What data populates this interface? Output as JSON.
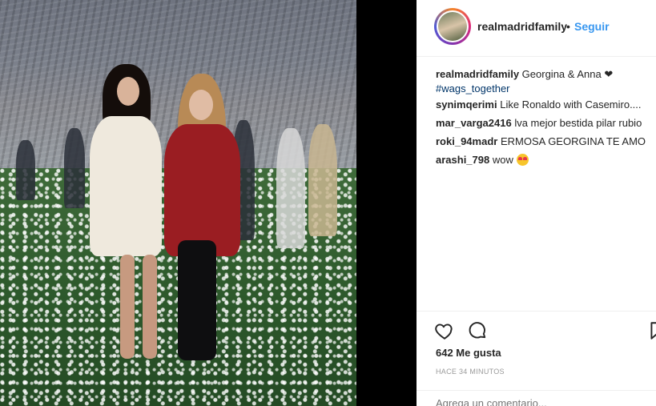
{
  "post": {
    "username": "realmadridfamily",
    "separator": "•",
    "follow_label": "Seguir",
    "caption_text": "Georgina & Anna",
    "caption_emoji": "❤",
    "hashtag": "#wags_together"
  },
  "comments": [
    {
      "user": "synimqerimi",
      "text": "Like Ronaldo with Casemiro...."
    },
    {
      "user": "mar_varga2416",
      "text": "lva mejor bestida pilar rubio"
    },
    {
      "user": "roki_94madr",
      "text": "ERMOSA GEORGINA TE AMO"
    },
    {
      "user": "arashi_798",
      "text": "wow"
    }
  ],
  "actions": {
    "likes_label": "642 Me gusta",
    "time_label": "HACE 34 MINUTOS",
    "add_comment_placeholder": "Agrega un comentario..."
  },
  "icons": {
    "like": "heart-icon",
    "comment": "comment-icon",
    "save": "bookmark-icon",
    "emoji": "heart-eyes-emoji"
  },
  "colors": {
    "link_blue": "#3897f0",
    "hashtag_blue": "#003569",
    "text": "#262626",
    "muted": "#999999",
    "divider": "#efefef"
  }
}
